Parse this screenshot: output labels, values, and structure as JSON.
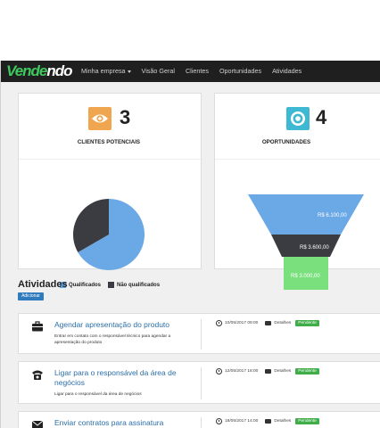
{
  "navbar": {
    "brand_main": "Vende",
    "brand_rest": "ndo",
    "items": [
      {
        "label": "Minha empresa"
      },
      {
        "label": "Visão Geral"
      },
      {
        "label": "Clientes"
      },
      {
        "label": "Oportunidades"
      },
      {
        "label": "Atividades"
      }
    ]
  },
  "stats": {
    "leads": {
      "count": "3",
      "label": "CLIENTES POTENCIAIS",
      "icon": "eye-icon",
      "color": "#f0a64e"
    },
    "opportunities": {
      "count": "4",
      "label": "OPORTUNIDADES",
      "icon": "target-icon",
      "color": "#3fb8d4"
    }
  },
  "pie": {
    "legend": [
      {
        "label": "Qualificados",
        "color": "#6aa9e6"
      },
      {
        "label": "Não qualificados",
        "color": "#3b3c41"
      }
    ],
    "values": [
      2,
      1
    ]
  },
  "funnel": {
    "stages": [
      {
        "label": "R$ 6.100,00",
        "color": "#6aa9e6"
      },
      {
        "label": "R$ 3.600,00",
        "color": "#3b3c41"
      },
      {
        "label": "R$ 3.000,00",
        "color": "#7ae07e"
      }
    ]
  },
  "activities": {
    "title": "Atividades",
    "add_label": "Adicionar",
    "items": [
      {
        "icon": "briefcase-icon",
        "title": "Agendar apresentação do produto",
        "desc": "Entrar em contato com o responsável técnico para agendar a apresentação do produto",
        "datetime": "10/05/2017 09:00",
        "details": "Detalhes",
        "status": "Pendente"
      },
      {
        "icon": "phone-icon",
        "title": "Ligar para o responsável da área de negócios",
        "desc": "Ligar para o responsável da área de negócios",
        "datetime": "12/05/2017 18:00",
        "details": "Detalhes",
        "status": "Pendente"
      },
      {
        "icon": "envelope-icon",
        "title": "Enviar contratos para assinatura",
        "desc": "",
        "datetime": "18/05/2017 14:00",
        "details": "Detalhes",
        "status": "Pendente"
      }
    ]
  }
}
